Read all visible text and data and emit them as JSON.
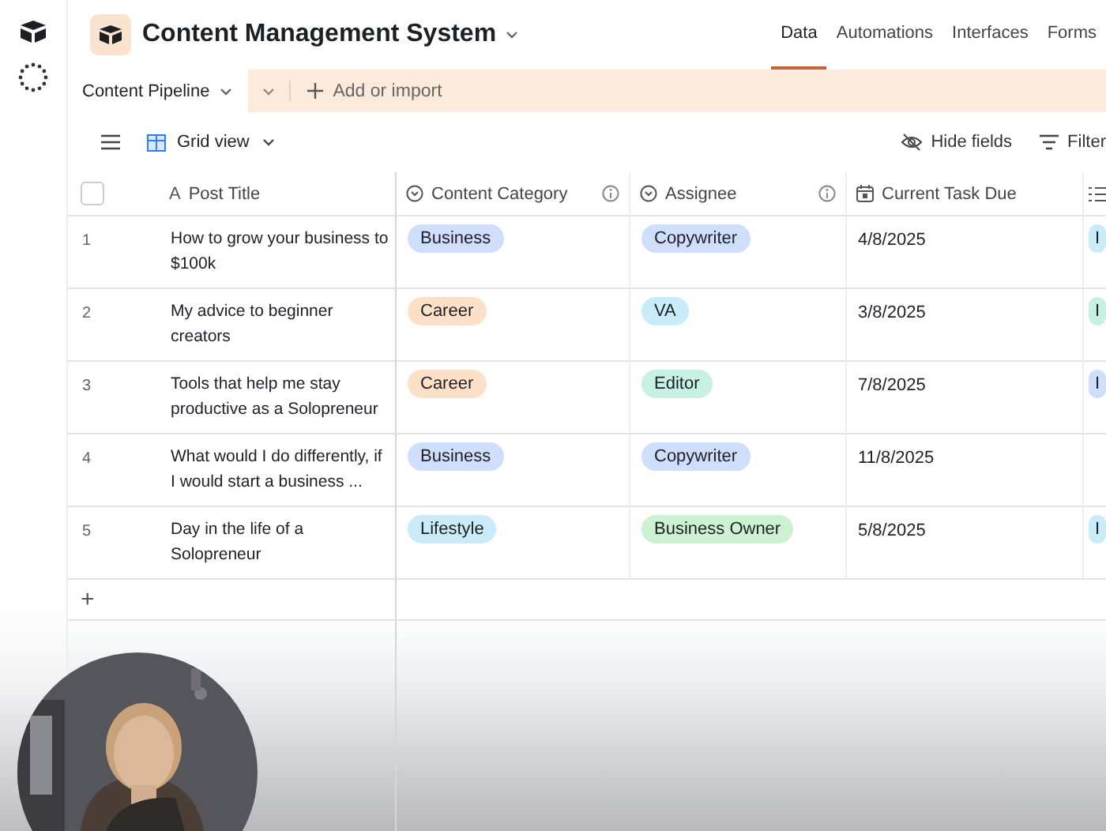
{
  "base": {
    "title": "Content Management System"
  },
  "nav_tabs": [
    {
      "label": "Data",
      "selected": true
    },
    {
      "label": "Automations",
      "selected": false
    },
    {
      "label": "Interfaces",
      "selected": false
    },
    {
      "label": "Forms",
      "selected": false
    }
  ],
  "table_tabs": [
    {
      "label": "Content Pipeline",
      "selected": true
    }
  ],
  "add_button": "Add or import",
  "toolbar": {
    "view": "Grid view",
    "actions": [
      "Hide fields",
      "Filter"
    ]
  },
  "table": {
    "select_all": {
      "checked": false
    },
    "columns": [
      {
        "kind": "text",
        "icon_char": "A",
        "label": "Post Title",
        "info": false
      },
      {
        "kind": "select",
        "label": "Content Category",
        "info": true
      },
      {
        "kind": "select",
        "label": "Assignee",
        "info": true
      },
      {
        "kind": "date",
        "label": "Current Task Due",
        "info": false
      },
      {
        "kind": "list"
      }
    ],
    "rows": [
      {
        "number": "1",
        "title": "How to grow your business to $100k",
        "category": {
          "label": "Business",
          "color": "#cfdffb"
        },
        "assignee": {
          "label": "Copywriter",
          "color": "#cfdffb"
        },
        "due": "4/8/2025",
        "column_5": {
          "label": "I",
          "color": "#c9ecf8"
        }
      },
      {
        "number": "2",
        "title": "My advice to beginner creators",
        "category": {
          "label": "Career",
          "color": "#fde0c8"
        },
        "assignee": {
          "label": "VA",
          "color": "#c9ecf8"
        },
        "due": "3/8/2025",
        "column_5": {
          "label": "I",
          "color": "#c6f1e3"
        }
      },
      {
        "number": "3",
        "title": "Tools that help me stay productive as a Solopreneur",
        "category": {
          "label": "Career",
          "color": "#fde0c8"
        },
        "assignee": {
          "label": "Editor",
          "color": "#c6f1e3"
        },
        "due": "7/8/2025",
        "column_5": {
          "label": "I",
          "color": "#cfdffb"
        }
      },
      {
        "number": "4",
        "title": "What would I do differently, if I would start a business ...",
        "category": {
          "label": "Business",
          "color": "#cfdffb"
        },
        "assignee": {
          "label": "Copywriter",
          "color": "#cfdffb"
        },
        "due": "11/8/2025"
      },
      {
        "number": "5",
        "title": "Day in the life of a Solopreneur",
        "category": {
          "label": "Lifestyle",
          "color": "#c9ecf8"
        },
        "assignee": {
          "label": "Business Owner",
          "color": "#cdf2d2"
        },
        "due": "5/8/2025",
        "column_5": {
          "label": "I",
          "color": "#c9ecf8"
        }
      }
    ],
    "add_row": "+"
  }
}
